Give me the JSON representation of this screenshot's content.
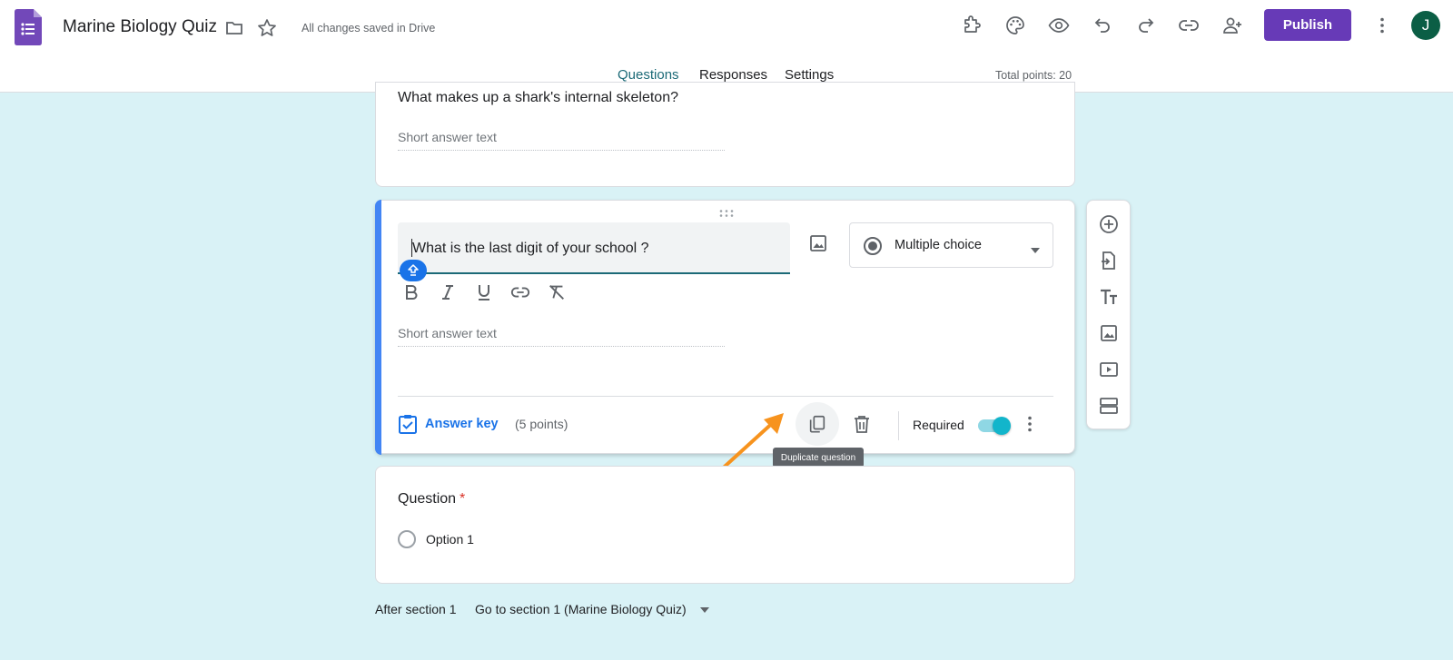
{
  "header": {
    "doc_title": "Marine Biology Quiz",
    "save_status": "All changes saved in Drive",
    "publish_label": "Publish",
    "avatar_initial": "J",
    "brand_color": "#673ab7",
    "icons": [
      "folder-icon",
      "star-icon",
      "addon-icon",
      "palette-icon",
      "preview-icon",
      "undo-icon",
      "redo-icon",
      "link-icon",
      "add-collaborator-icon",
      "more-vert-icon"
    ]
  },
  "tabs": [
    {
      "label": "Questions",
      "active": true
    },
    {
      "label": "Responses",
      "active": false
    },
    {
      "label": "Settings",
      "active": false
    }
  ],
  "total_points": "Total points: 20",
  "question1": {
    "title": "What makes up a shark's internal skeleton?",
    "placeholder": "Short answer text"
  },
  "question2": {
    "title": "What is the last digit of your school ?",
    "placeholder": "Short answer text",
    "type": "Multiple choice",
    "answer_key": "Answer key",
    "points": "(5 points)",
    "required_label": "Required",
    "required": true,
    "tooltip": "Duplicate question"
  },
  "question3": {
    "title": "Question",
    "required_marker": "*",
    "option1": "Option 1"
  },
  "footer": {
    "after_section": "After section 1",
    "go_to": "Go to section 1 (Marine Biology Quiz)"
  },
  "side_toolbar": [
    "add-question-icon",
    "import-questions-icon",
    "add-title-icon",
    "add-image-icon",
    "add-video-icon",
    "add-section-icon"
  ],
  "colors": {
    "accent": "#1c6a77",
    "background": "#d9f2f6",
    "highlight_bar": "#4285f4",
    "annotation_arrow": "#f7931e"
  }
}
